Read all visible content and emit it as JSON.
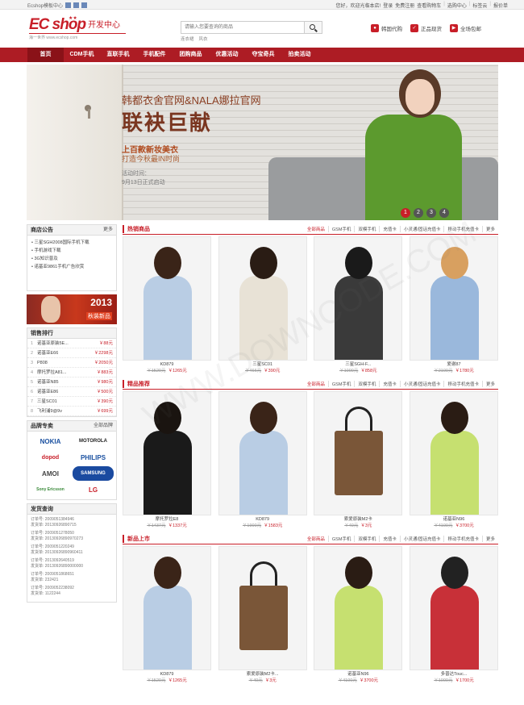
{
  "topbar": {
    "left_text": "Ecshop模板中心",
    "right_links": [
      "您好，欢迎光临本店!",
      "登录",
      "免费注册",
      "查看购物车",
      "选购中心",
      "标签云",
      "报价单"
    ]
  },
  "logo": {
    "word": "EC shop",
    "sub": "开发中心",
    "slogan": "海一世界 www.ecshop.com"
  },
  "search": {
    "placeholder": "请输入您要查询的商品",
    "hot": [
      "连衣裙",
      "风衣"
    ]
  },
  "services": [
    {
      "icon": "korea-icon",
      "label": "韩国代购"
    },
    {
      "icon": "shield-icon",
      "label": "正品现货"
    },
    {
      "icon": "truck-icon",
      "label": "全场包邮"
    }
  ],
  "nav": [
    "首页",
    "CDM手机",
    "直联手机",
    "手机配件",
    "团购商品",
    "优惠活动",
    "夺宝奇兵",
    "拍卖活动"
  ],
  "banner": {
    "line1": "韩都衣舍官网&NALA娜拉官网",
    "line2": "联袂巨献",
    "line3": "上百款新妆美衣",
    "line4": "打造今秋最IN时尚",
    "line5": "活动时间：",
    "line6": "9月13日正式启动",
    "dots": [
      "1",
      "2",
      "3",
      "4"
    ],
    "active_dot": "1"
  },
  "sidebar": {
    "notice": {
      "title": "商店公告",
      "more": "更多",
      "items": [
        "三星SGH2008国际手机下载",
        "手机游戏下载",
        "3G知识普及",
        "诺基亚9861手机广告欣赏"
      ]
    },
    "promo": {
      "year": "2013",
      "text": "秋装新品"
    },
    "rank": {
      "title": "销售排行",
      "items": [
        {
          "n": "1",
          "name": "诺基亚原装5E...",
          "price": "￥88元"
        },
        {
          "n": "2",
          "name": "诺基亚E66",
          "price": "￥2298元"
        },
        {
          "n": "3",
          "name": "P808",
          "price": "￥2050元"
        },
        {
          "n": "4",
          "name": "摩托罗拉A81...",
          "price": "￥883元"
        },
        {
          "n": "5",
          "name": "诺基亚N85",
          "price": "￥980元"
        },
        {
          "n": "6",
          "name": "诺基亚E86",
          "price": "￥500元"
        },
        {
          "n": "7",
          "name": "三星SC01",
          "price": "￥390元"
        },
        {
          "n": "8",
          "name": "飞利浦9@9v",
          "price": "￥699元"
        }
      ]
    },
    "brands": {
      "title": "品牌专卖",
      "more": "全部品牌",
      "items": [
        "NOKIA",
        "MOTOROLA",
        "dopod",
        "PHILIPS",
        "AMOI",
        "SAMSUNG",
        "Sony Ericsson",
        "LG"
      ]
    },
    "shipping": {
      "title": "发货查询",
      "records": [
        {
          "order": "订单号: 2009051384946",
          "ship": "发货单: 20130926890715"
        },
        {
          "order": "订单号: 2009051278050",
          "ship": "发货单: 20130926890970273"
        },
        {
          "order": "订单号: 2009051220249",
          "ship": "发货单: 20130926890960411"
        },
        {
          "order": "订单号: 2013092640519",
          "ship": "发货单: 20130926890000000"
        },
        {
          "order": "订单号: 2009051868651",
          "ship": "发货单: 232421"
        },
        {
          "order": "订单号: 2009052238092",
          "ship": "发货单: 1122244"
        }
      ]
    }
  },
  "sections": [
    {
      "title": "热销商品",
      "tabs": [
        "全部商品",
        "GSM手机",
        "双模手机",
        "充值卡",
        "小灵通/固话充值卡",
        "移动手机充值卡",
        "更多"
      ],
      "items": [
        {
          "name": "KD879",
          "old": "￥1520元",
          "now": "￥1265元"
        },
        {
          "name": "三星SC01",
          "old": "￥466元",
          "now": "￥390元"
        },
        {
          "name": "三星SGH-F...",
          "old": "￥1000元",
          "now": "￥858元"
        },
        {
          "name": "爱谢87",
          "old": "￥2100元",
          "now": "￥1780元"
        }
      ]
    },
    {
      "title": "精品推荐",
      "tabs": [
        "全部商品",
        "GSM手机",
        "双模手机",
        "充值卡",
        "小灵通/固话充值卡",
        "移动手机充值卡",
        "更多"
      ],
      "items": [
        {
          "name": "摩托罗拉E8",
          "old": "￥1437元",
          "now": "￥1337元"
        },
        {
          "name": "KD879",
          "old": "￥1900元",
          "now": "￥1583元"
        },
        {
          "name": "索爱原装M2卡",
          "old": "￥40元",
          "now": "￥3元"
        },
        {
          "name": "诺基亚N96",
          "old": "￥4100元",
          "now": "￥3700元"
        }
      ]
    },
    {
      "title": "新品上市",
      "tabs": [
        "全部商品",
        "GSM手机",
        "双模手机",
        "充值卡",
        "小灵通/固话充值卡",
        "移动手机充值卡",
        "更多"
      ],
      "items": [
        {
          "name": "KD879",
          "old": "￥1520元",
          "now": "￥1265元"
        },
        {
          "name": "索爱原装M2卡...",
          "old": "￥40元",
          "now": "￥3元"
        },
        {
          "name": "诺基亚N96",
          "old": "￥4100元",
          "now": "￥3700元"
        },
        {
          "name": "多普达Touc...",
          "old": "￥1000元",
          "now": "￥1700元"
        }
      ]
    }
  ]
}
